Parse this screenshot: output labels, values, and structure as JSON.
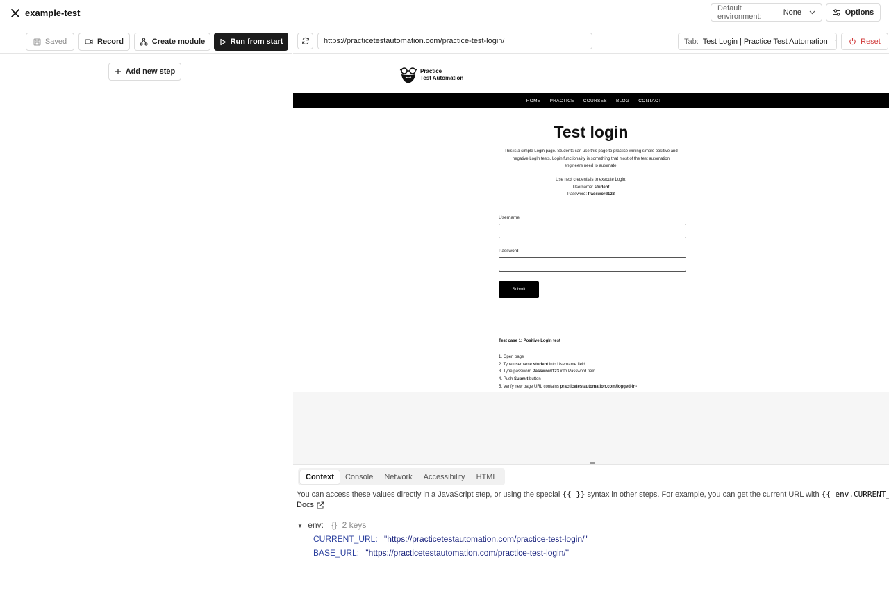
{
  "header": {
    "title": "example-test",
    "env_label": "Default environment:",
    "env_value": "None",
    "options_label": "Options"
  },
  "toolbar": {
    "saved_label": "Saved",
    "record_label": "Record",
    "create_module_label": "Create module",
    "run_label": "Run from start",
    "add_step_label": "Add new step"
  },
  "browser": {
    "url": "https://practicetestautomation.com/practice-test-login/",
    "tab_label": "Tab:",
    "tab_value": "Test Login | Practice Test Automation",
    "reset_label": "Reset"
  },
  "site": {
    "logo_line1": "Practice",
    "logo_line2": "Test Automation",
    "nav": [
      "HOME",
      "PRACTICE",
      "COURSES",
      "BLOG",
      "CONTACT"
    ],
    "heading": "Test login",
    "intro": "This is a simple Login page. Students can use this page to practice writing simple positive and negative LogIn tests. Login functionality is something that most of the test automation engineers need to automate.",
    "creds_intro": "Use next credentials to execute Login:",
    "username_label_prefix": "Username:",
    "username_value": "student",
    "password_label_prefix": "Password:",
    "password_value": "Password123",
    "username_field_label": "Username",
    "password_field_label": "Password",
    "submit_label": "Submit",
    "test_case_title": "Test case 1: Positive LogIn test",
    "steps": [
      {
        "num": "1.",
        "pre": "Open page",
        "bold": "",
        "post": ""
      },
      {
        "num": "2.",
        "pre": "Type username ",
        "bold": "student",
        "post": " into Username field"
      },
      {
        "num": "3.",
        "pre": "Type password ",
        "bold": "Password123",
        "post": " into Password field"
      },
      {
        "num": "4.",
        "pre": "Push ",
        "bold": "Submit",
        "post": " button"
      },
      {
        "num": "5.",
        "pre": "Verify new page URL contains ",
        "bold": "practicetestautomation.com/logged-in-",
        "post": ""
      }
    ]
  },
  "devtools": {
    "tabs": [
      "Context",
      "Console",
      "Network",
      "Accessibility",
      "HTML"
    ],
    "active_tab": "Context",
    "desc_part1": "You can access these values directly in a JavaScript step, or using the special ",
    "desc_code1": "{{ }}",
    "desc_part2": " syntax in other steps. For example, you can get the current URL with ",
    "desc_code2": "{{ env.CURRENT_URL }}.",
    "docs_label": "Docs",
    "env_key": "env:",
    "env_meta_braces": "{}",
    "env_meta_count": "2 keys",
    "entries": [
      {
        "key": "CURRENT_URL:",
        "value": "\"https://practicetestautomation.com/practice-test-login/\""
      },
      {
        "key": "BASE_URL:",
        "value": "\"https://practicetestautomation.com/practice-test-login/\""
      }
    ]
  },
  "colors": {
    "run_button": "#1c1c1c",
    "reset_text": "#d13b3b",
    "string_value": "#1a237e"
  }
}
